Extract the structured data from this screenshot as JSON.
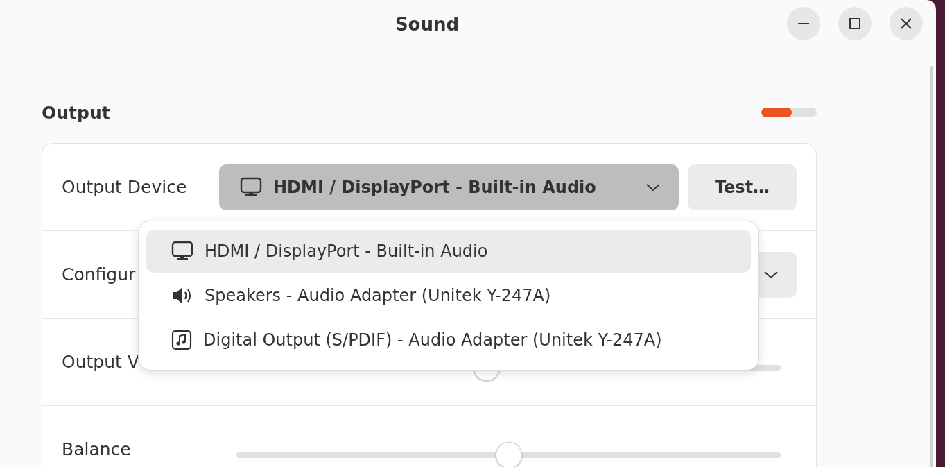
{
  "window": {
    "title": "Sound"
  },
  "output": {
    "heading": "Output",
    "meter": {
      "level": 0.55
    },
    "rows": [
      {
        "kind": "device",
        "label": "Output Device",
        "value": "HDMI / DisplayPort - Built-in Audio",
        "button": "Test…"
      },
      {
        "kind": "dropdown",
        "label": "Configur"
      },
      {
        "kind": "slider",
        "label": "Output V",
        "level": 0.46
      },
      {
        "kind": "slider",
        "label": "Balance",
        "level": 0.5
      }
    ]
  },
  "device_menu": {
    "items": [
      {
        "kind": "monitor",
        "label": "HDMI / DisplayPort - Built-in Audio",
        "selected": true
      },
      {
        "kind": "speaker",
        "label": "Speakers - Audio Adapter (Unitek Y-247A)",
        "selected": false
      },
      {
        "kind": "music",
        "label": "Digital Output (S/PDIF) - Audio Adapter (Unitek Y-247A)",
        "selected": false
      }
    ]
  }
}
